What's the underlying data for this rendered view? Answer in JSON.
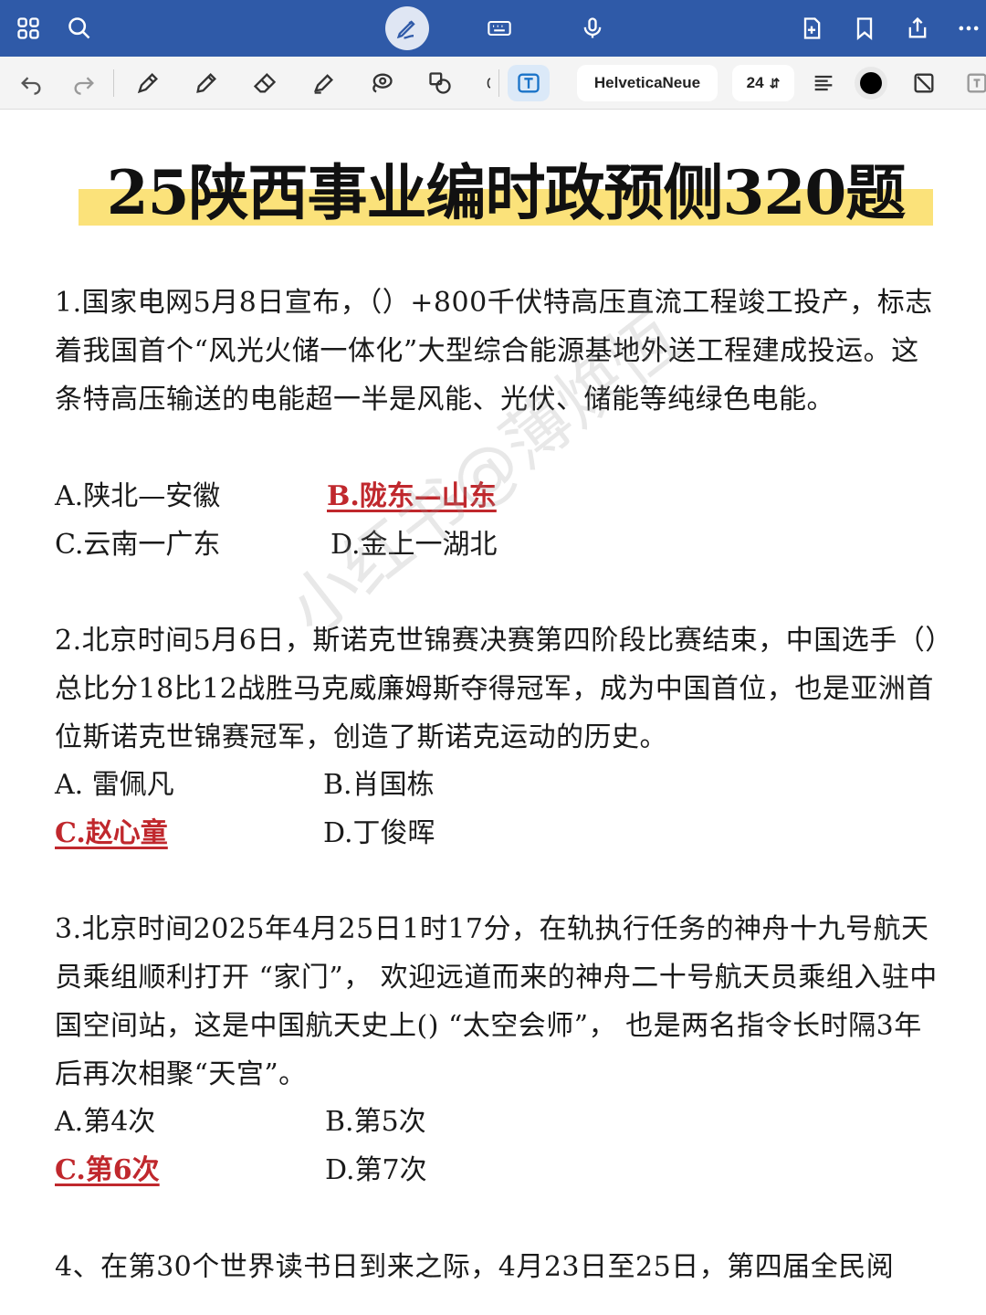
{
  "topbar": {
    "icons": [
      "grid-icon",
      "search-icon",
      "pen-edit-icon",
      "keyboard-icon",
      "microphone-icon",
      "add-page-icon",
      "bookmark-icon",
      "share-icon",
      "more-icon"
    ],
    "accent": "#2f5aa8"
  },
  "toolbar": {
    "font_name": "HelveticaNeue",
    "font_size": "24",
    "color": "#000000"
  },
  "document": {
    "title": "25陕西事业编时政预侧320题",
    "highlight_color": "#fbe27a",
    "answer_color": "#c0282d",
    "watermark": "小红书@薄焕恆",
    "questions": [
      {
        "text": "1.国家电网5月8日宣布，（）+800千伏特高压直流工程竣工投产，标志着我国首个“风光火储一体化”大型综合能源基地外送工程建成投运。这条特高压输送的电能超一半是风能、光伏、储能等纯绿色电能。",
        "options": [
          "A.陕北—安徽",
          "B.陇东—山东",
          "C.云南一广东",
          "D.金上一湖北"
        ],
        "answer": "B"
      },
      {
        "text": "2.北京时间5月6日，斯诺克世锦赛决赛第四阶段比赛结束，中国选手（）总比分18比12战胜马克威廉姆斯夺得冠军，成为中国首位，也是亚洲首位斯诺克世锦赛冠军，创造了斯诺克运动的历史。",
        "options": [
          "A. 雷佩凡",
          "B.肖国栋",
          "C.赵心童",
          "D.丁俊晖"
        ],
        "answer": "C"
      },
      {
        "text": "3.北京时间2025年4月25日1时17分，在轨执行任务的神舟十九号航天员乘组顺利打开 “家门”， 欢迎远道而来的神舟二十号航天员乘组入驻中国空间站，这是中国航天史上() “太空会师”， 也是两名指令长时隔3年后再次相聚“天宫”。",
        "options": [
          "A.第4次",
          "B.第5次",
          "C.第6次",
          "D.第7次"
        ],
        "answer": "C"
      },
      {
        "text": "4、在第30个世界读书日到来之际，4月23日至25日，第四届全民阅"
      }
    ]
  }
}
